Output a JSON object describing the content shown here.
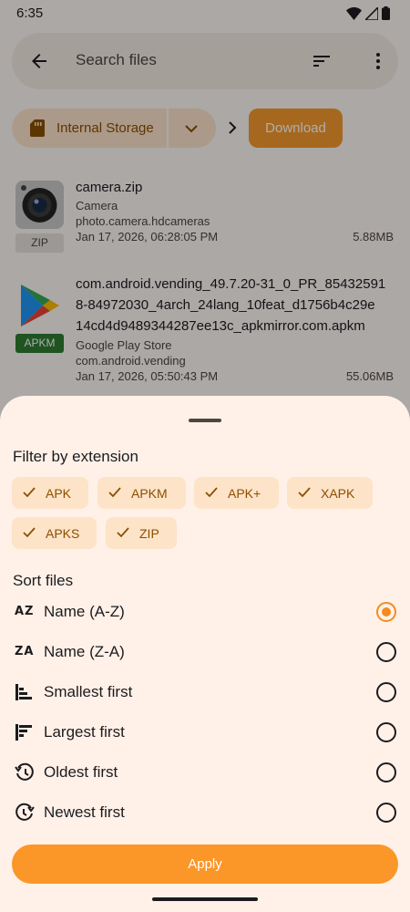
{
  "status_bar": {
    "time": "6:35"
  },
  "search": {
    "placeholder": "Search files"
  },
  "breadcrumb": {
    "storage_label": "Internal Storage",
    "current_folder": "Download"
  },
  "files": [
    {
      "name": "camera.zip",
      "app_name": "Camera",
      "package": "photo.camera.hdcameras",
      "date": "Jan 17, 2026, 06:28:05 PM",
      "size": "5.88MB",
      "badge": "ZIP",
      "icon": "camera-app-icon"
    },
    {
      "name_line1": "com.android.vending_49.7.20-31_0_PR_85432591",
      "name_line2": "8-84972030_4arch_24lang_10feat_d1756b4c29e",
      "name_line3": "14cd4d9489344287ee13c_apkmirror.com.apkm",
      "app_name": "Google Play Store",
      "package": "com.android.vending",
      "date": "Jan 17, 2026, 05:50:43 PM",
      "size": "55.06MB",
      "badge": "APKM",
      "icon": "google-play-icon"
    }
  ],
  "sheet": {
    "filter_title": "Filter by extension",
    "extensions": [
      "APK",
      "APKM",
      "APK+",
      "XAPK",
      "APKS",
      "ZIP"
    ],
    "sort_title": "Sort files",
    "sort_options": [
      {
        "label": "Name (A-Z)",
        "icon": "sort-az-icon",
        "glyph": "AZ",
        "selected": true
      },
      {
        "label": "Name (Z-A)",
        "icon": "sort-za-icon",
        "glyph": "ZA",
        "selected": false
      },
      {
        "label": "Smallest first",
        "icon": "sort-size-ascending-icon",
        "selected": false
      },
      {
        "label": "Largest first",
        "icon": "sort-size-descending-icon",
        "selected": false
      },
      {
        "label": "Oldest first",
        "icon": "history-icon",
        "selected": false
      },
      {
        "label": "Newest first",
        "icon": "clock-forward-icon",
        "selected": false
      }
    ],
    "apply_label": "Apply"
  },
  "colors": {
    "accent": "#f28c1f",
    "apply_button": "#fb9628",
    "chip_bg": "#fde3c8",
    "chip_text": "#8a4f00",
    "sheet_bg": "#fff1e8",
    "apkm_badge": "#2e7d32"
  }
}
